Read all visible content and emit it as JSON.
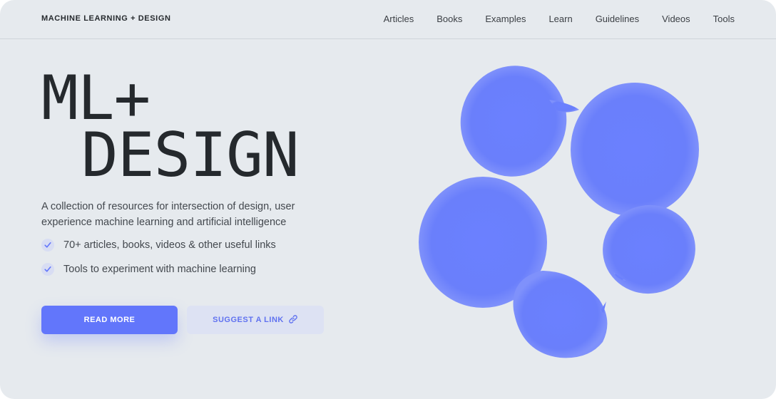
{
  "brand": "MACHINE LEARNING + DESIGN",
  "nav": [
    "Articles",
    "Books",
    "Examples",
    "Learn",
    "Guidelines",
    "Videos",
    "Tools"
  ],
  "hero": {
    "line1": "ML+",
    "line2": "DESIGN",
    "description": "A collection of resources for intersection of design, user experience machine learning and artificial intelligence",
    "features": [
      "70+ articles, books, videos & other useful links",
      "Tools to experiment with machine learning"
    ]
  },
  "buttons": {
    "primary": "READ MORE",
    "secondary": "SUGGEST A LINK"
  },
  "colors": {
    "accent": "#6276fb",
    "background": "#e6eaee",
    "text": "#25292d"
  },
  "icons": {
    "check": "check-icon",
    "link": "link-icon"
  }
}
